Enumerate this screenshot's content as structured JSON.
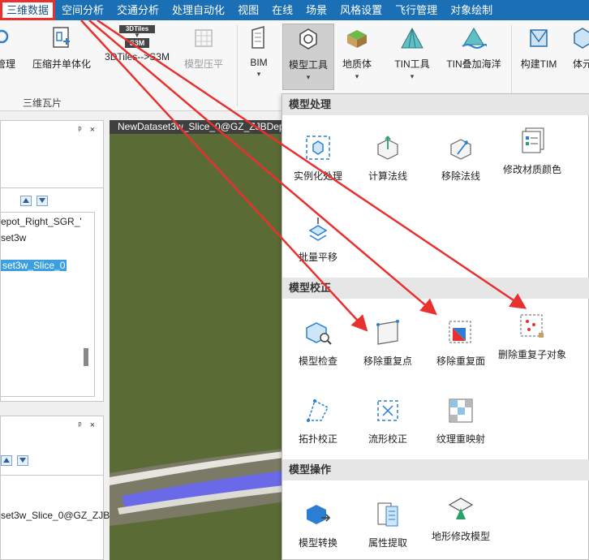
{
  "menubar": {
    "tabs": [
      "三维数据",
      "空间分析",
      "交通分析",
      "处理自动化",
      "视图",
      "在线",
      "场景",
      "风格设置",
      "飞行管理",
      "对象绘制"
    ],
    "highlight_color": "#e8312f"
  },
  "ribbon": {
    "buttons": {
      "manage": "管理",
      "compress": "压缩并单体化",
      "tiles_badge_top": "3DTiles",
      "tiles_badge_bottom": "S3M",
      "tiles": "3DTiles-->S3M",
      "model_flatten": "模型压平",
      "bim": "BIM",
      "model_tools": "模型工具",
      "geology": "地质体",
      "tin_tools": "TIN工具",
      "tin_ocean": "TIN叠加海洋",
      "build_tim": "构建TIM",
      "voxel": "体元"
    },
    "group_label": "三维瓦片"
  },
  "left_panel_top": {
    "pin": "ᵖ",
    "close": "×",
    "tree": [
      "epot_Right_SGR_'",
      "set3w",
      "set3w_Slice_0"
    ]
  },
  "left_panel_bottom": {
    "pin": "ᵖ",
    "close": "×",
    "tree": [
      "set3w_Slice_0@GZ_ZJB"
    ]
  },
  "viewport": {
    "tab_title": "NewDataset3w_Slice_0@GZ_ZJBDep"
  },
  "dropdown": {
    "sections": [
      {
        "title": "模型处理",
        "items": [
          "实例化处理",
          "计算法线",
          "移除法线",
          "修改材质颜色",
          "批量平移"
        ]
      },
      {
        "title": "模型校正",
        "items": [
          "模型检查",
          "移除重复点",
          "移除重复面",
          "删除重复子对象",
          "拓扑校正",
          "流形校正",
          "纹理重映射"
        ]
      },
      {
        "title": "模型操作",
        "items": [
          "模型转换",
          "属性提取",
          "地形修改模型"
        ]
      }
    ]
  },
  "annotation_color": "#e8312f"
}
